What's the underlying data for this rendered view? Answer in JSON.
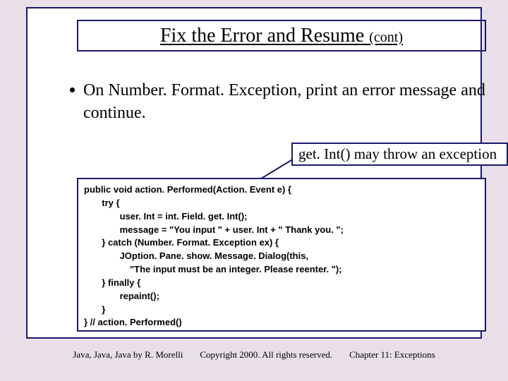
{
  "title": {
    "main": "Fix the Error and Resume ",
    "cont": "(cont)"
  },
  "bullet": {
    "text": "On Number. Format. Exception, print an error message and continue."
  },
  "callout": {
    "text": "get. Int() may throw an exception"
  },
  "code": {
    "l0": "public void action. Performed(Action. Event e) {",
    "l1": "       try {",
    "l2": "              user. Int = int. Field. get. Int();",
    "l3": "              message = \"You input \" + user. Int + \" Thank you. \";",
    "l4": "       } catch (Number. Format. Exception ex) {",
    "l5": "              JOption. Pane. show. Message. Dialog(this,",
    "l6": "                  \"The input must be an integer. Please reenter. \");",
    "l7": "       } finally {",
    "l8": "              repaint();",
    "l9": "       }",
    "l10": "} // action. Performed()"
  },
  "footer": {
    "left": "Java, Java, Java by R. Morelli",
    "center": "Copyright 2000. All rights reserved.",
    "right": "Chapter 11: Exceptions"
  }
}
